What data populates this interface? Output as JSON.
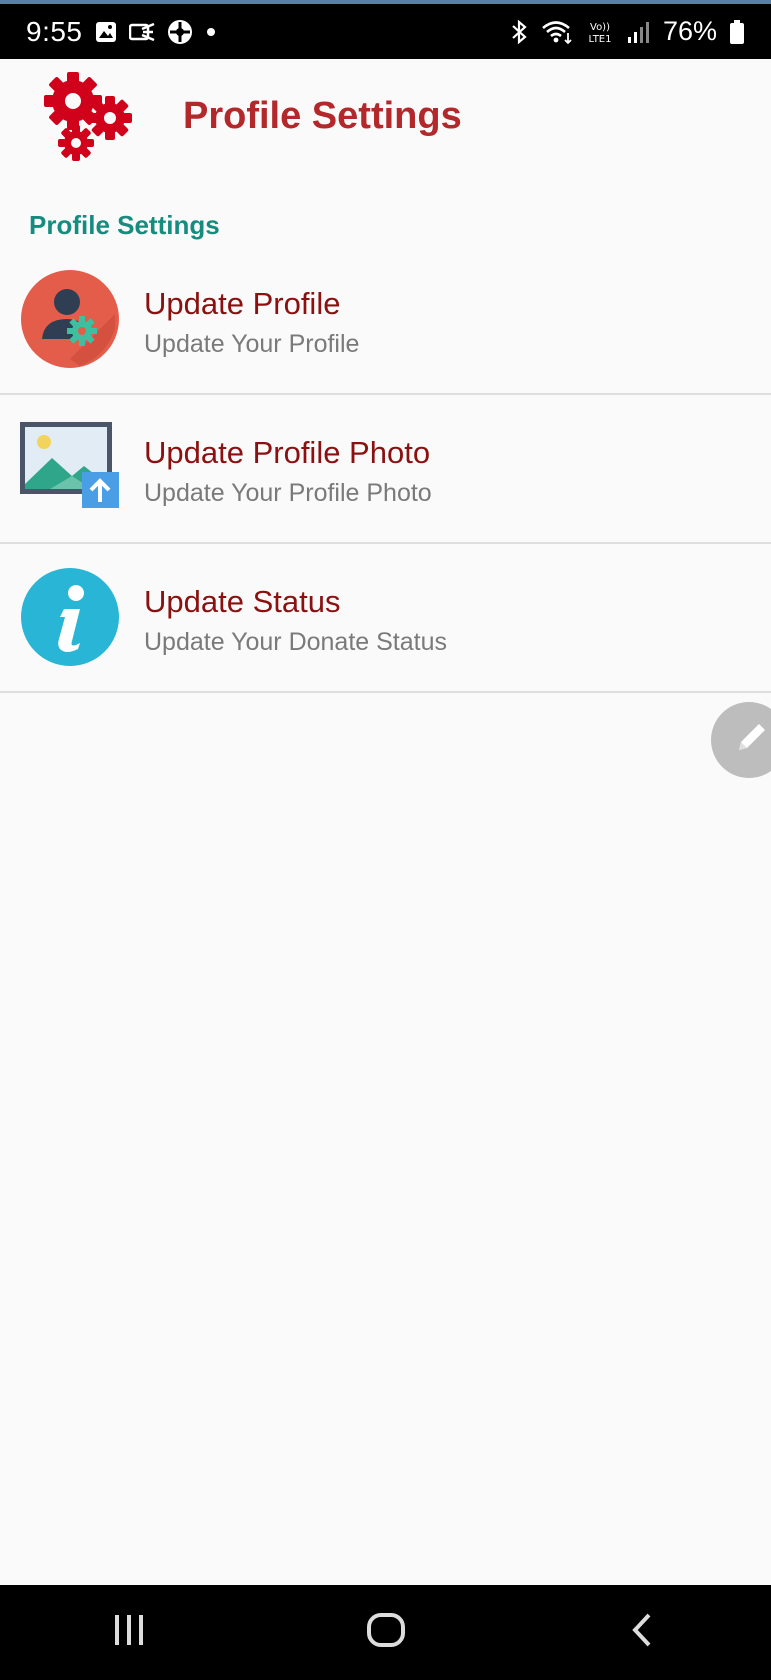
{
  "status_bar": {
    "time": "9:55",
    "battery_pct": "76%",
    "left_icons": [
      "image-icon",
      "cast-icon",
      "app-icon",
      "dot-icon"
    ],
    "right_icons": [
      "bluetooth-icon",
      "wifi-icon",
      "volte-icon",
      "signal-icon",
      "battery-icon"
    ]
  },
  "header": {
    "title": "Profile Settings",
    "logo_icon": "gears-icon",
    "accent": "#b3282b"
  },
  "section": {
    "title": "Profile Settings",
    "color": "#168c7f"
  },
  "items": [
    {
      "title": "Update Profile",
      "subtitle": "Update Your Profile",
      "icon": "user-settings-icon"
    },
    {
      "title": "Update Profile Photo",
      "subtitle": "Update Your Profile Photo",
      "icon": "photo-upload-icon"
    },
    {
      "title": "Update Status",
      "subtitle": "Update Your Donate Status",
      "icon": "info-icon"
    }
  ],
  "fab": {
    "icon": "pencil-icon"
  },
  "nav": {
    "icons": [
      "recents-icon",
      "home-icon",
      "back-icon"
    ]
  },
  "colors": {
    "item_title": "#8b1111",
    "item_subtitle": "#7a7a7a",
    "background": "#fafafa"
  }
}
